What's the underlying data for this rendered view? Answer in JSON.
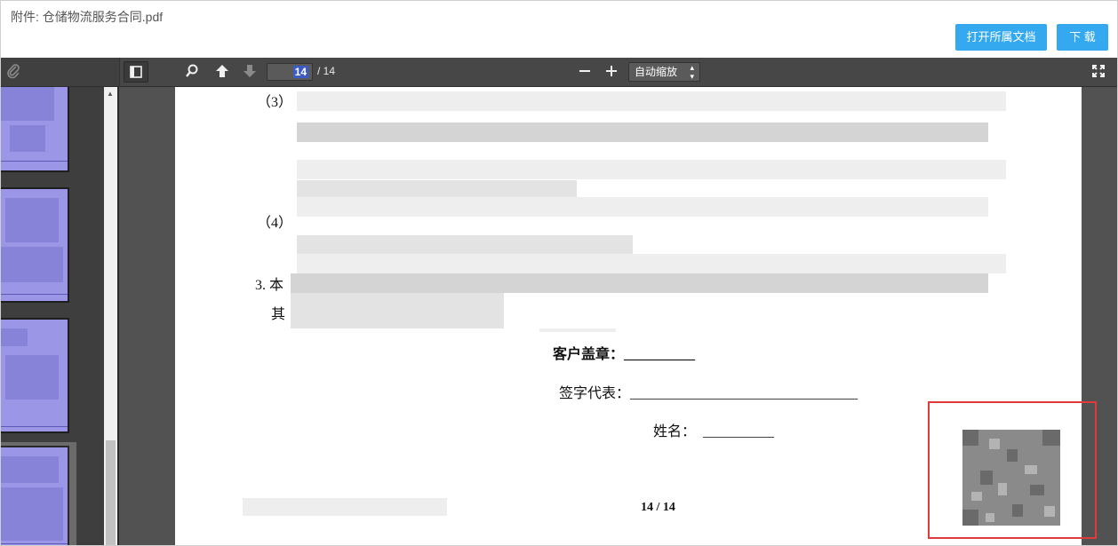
{
  "header": {
    "attachment_label": "附件: 仓储物流服务合同.pdf",
    "open_doc_button": "打开所属文档",
    "download_button": "下 载"
  },
  "toolbar": {
    "current_page": "14",
    "total_pages": "/ 14",
    "zoom_value": "自动缩放",
    "icons": [
      "attachment-icon",
      "sidebar-toggle-icon",
      "search-icon",
      "previous-page-icon",
      "next-page-icon",
      "zoom-out-icon",
      "zoom-in-icon",
      "fullscreen-icon"
    ]
  },
  "document": {
    "item3_label": "（3）",
    "item4_label": "（4）",
    "section3_prefix": "3. 本",
    "section3_cont": "其",
    "customer_seal": "客户盖章：__________",
    "signatory": "签字代表：________________________________",
    "name_field": "姓名：  __________",
    "page_footer": "14 / 14"
  },
  "colors": {
    "accent": "#35a9ef",
    "highlight_box": "#e03a3a",
    "thumbnail_fill": "#9b97e6"
  }
}
